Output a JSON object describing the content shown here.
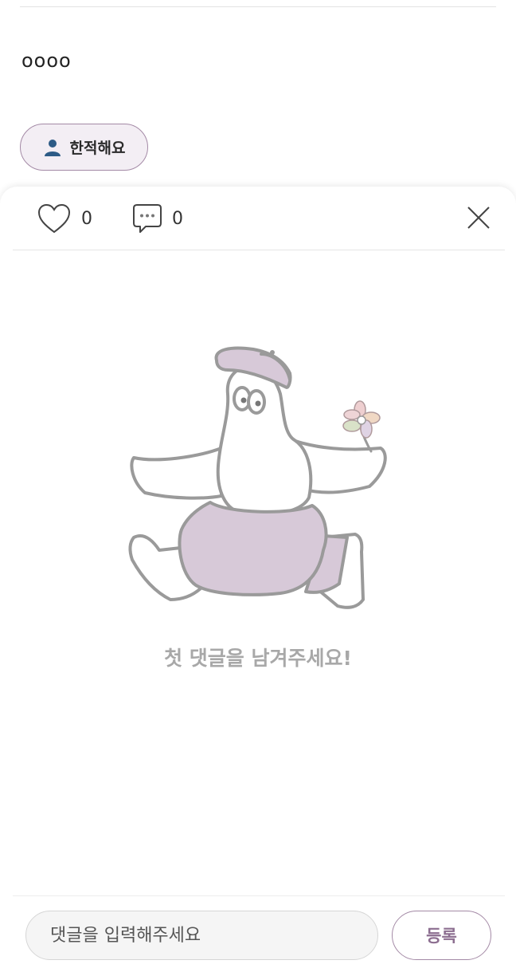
{
  "post": {
    "body_text": "oooo",
    "reaction_chip": {
      "icon": "person-icon",
      "label": "한적해요"
    }
  },
  "comments_sheet": {
    "like": {
      "icon": "heart-icon",
      "count": "0"
    },
    "comment": {
      "icon": "speech-bubble-icon",
      "count": "0"
    },
    "close_icon": "close-icon",
    "illustration": "mascot-character-with-flower",
    "empty_message": "첫 댓글을 남겨주세요!",
    "input": {
      "placeholder": "댓글을 입력해주세요",
      "value": ""
    },
    "submit_label": "등록"
  },
  "colors": {
    "accent_border": "#a48aa6",
    "chip_background": "#f3eef4",
    "submit_text": "#8c6e90",
    "mascot_purple": "#d7c9d8",
    "empty_text": "#a8a8a8"
  }
}
